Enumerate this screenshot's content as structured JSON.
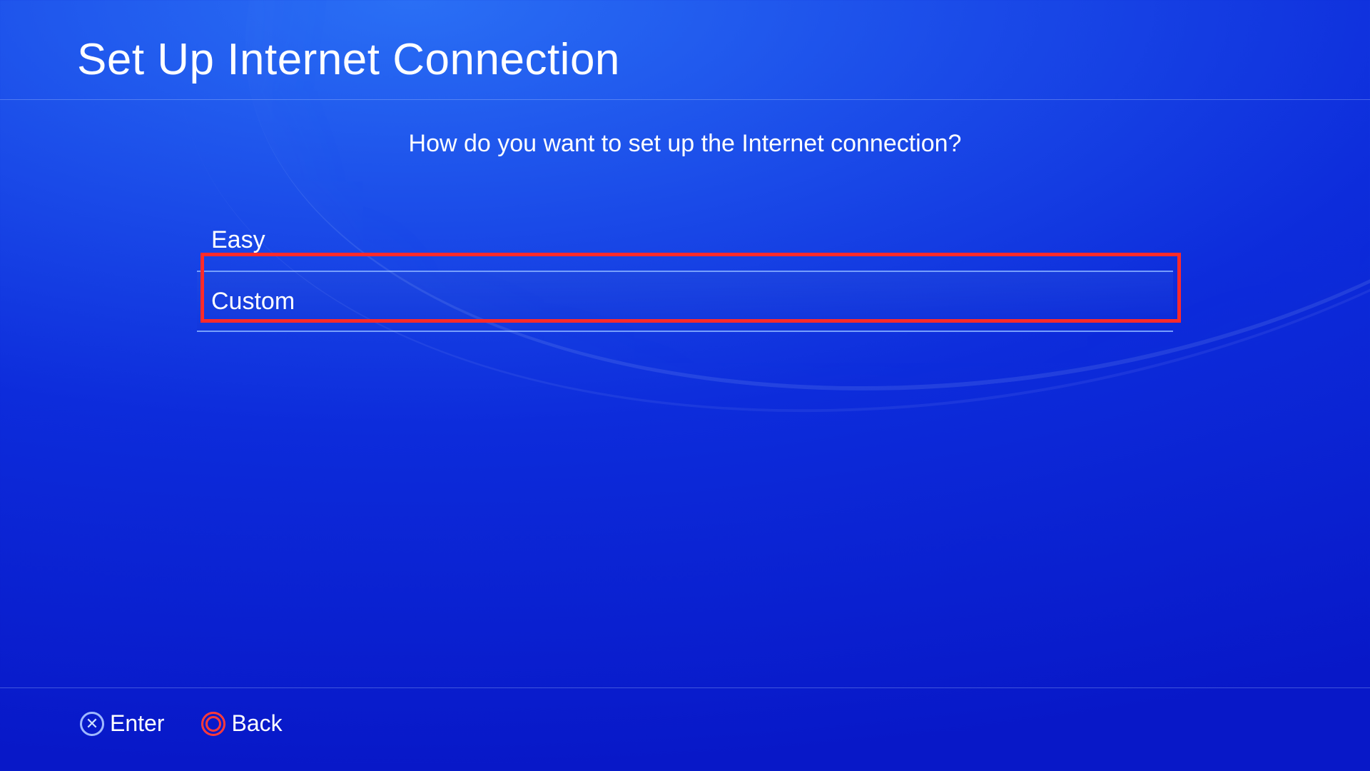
{
  "header": {
    "title": "Set Up Internet Connection"
  },
  "main": {
    "prompt": "How do you want to set up the Internet connection?",
    "options": [
      {
        "label": "Easy",
        "selected": false
      },
      {
        "label": "Custom",
        "selected": true
      }
    ]
  },
  "footer": {
    "enter_label": "Enter",
    "back_label": "Back"
  }
}
